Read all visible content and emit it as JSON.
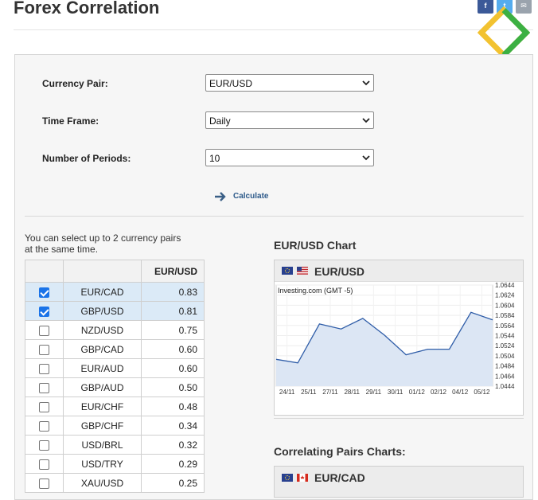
{
  "page": {
    "title": "Forex Correlation"
  },
  "form": {
    "currency_pair": {
      "label": "Currency Pair:",
      "value": "EUR/USD"
    },
    "time_frame": {
      "label": "Time Frame:",
      "value": "Daily"
    },
    "periods": {
      "label": "Number of Periods:",
      "value": "10"
    },
    "calculate_label": "Calculate"
  },
  "pairs": {
    "hint": "You can select up to 2 currency pairs at the same time.",
    "header": "EUR/USD",
    "rows": [
      {
        "pair": "EUR/CAD",
        "value": "0.83",
        "checked": true
      },
      {
        "pair": "GBP/USD",
        "value": "0.81",
        "checked": true
      },
      {
        "pair": "NZD/USD",
        "value": "0.75",
        "checked": false
      },
      {
        "pair": "GBP/CAD",
        "value": "0.60",
        "checked": false
      },
      {
        "pair": "EUR/AUD",
        "value": "0.60",
        "checked": false
      },
      {
        "pair": "GBP/AUD",
        "value": "0.50",
        "checked": false
      },
      {
        "pair": "EUR/CHF",
        "value": "0.48",
        "checked": false
      },
      {
        "pair": "GBP/CHF",
        "value": "0.34",
        "checked": false
      },
      {
        "pair": "USD/BRL",
        "value": "0.32",
        "checked": false
      },
      {
        "pair": "USD/TRY",
        "value": "0.29",
        "checked": false
      },
      {
        "pair": "XAU/USD",
        "value": "0.25",
        "checked": false
      }
    ]
  },
  "chart": {
    "section_title": "EUR/USD Chart",
    "pair": "EUR/USD",
    "source": "Investing.com (GMT -5)",
    "colors": {
      "line": "#2f5da8",
      "fill": "#dce6f4"
    }
  },
  "chart_data": {
    "type": "area",
    "x": [
      "24/11",
      "25/11",
      "27/11",
      "28/11",
      "29/11",
      "30/11",
      "01/12",
      "02/12",
      "04/12",
      "05/12"
    ],
    "values": [
      1.0497,
      1.049,
      1.0567,
      1.0557,
      1.0578,
      1.0545,
      1.0506,
      1.0517,
      1.0517,
      1.059,
      1.0575
    ],
    "yticks": [
      "1.0644",
      "1.0624",
      "1.0604",
      "1.0584",
      "1.0564",
      "1.0544",
      "1.0524",
      "1.0504",
      "1.0484",
      "1.0464",
      "1.0444"
    ],
    "ylim": [
      1.0444,
      1.0644
    ]
  },
  "correlating": {
    "title": "Correlating Pairs Charts:",
    "first_pair": "EUR/CAD"
  },
  "share": {
    "facebook": "f",
    "twitter": "t",
    "mail": "✉"
  }
}
